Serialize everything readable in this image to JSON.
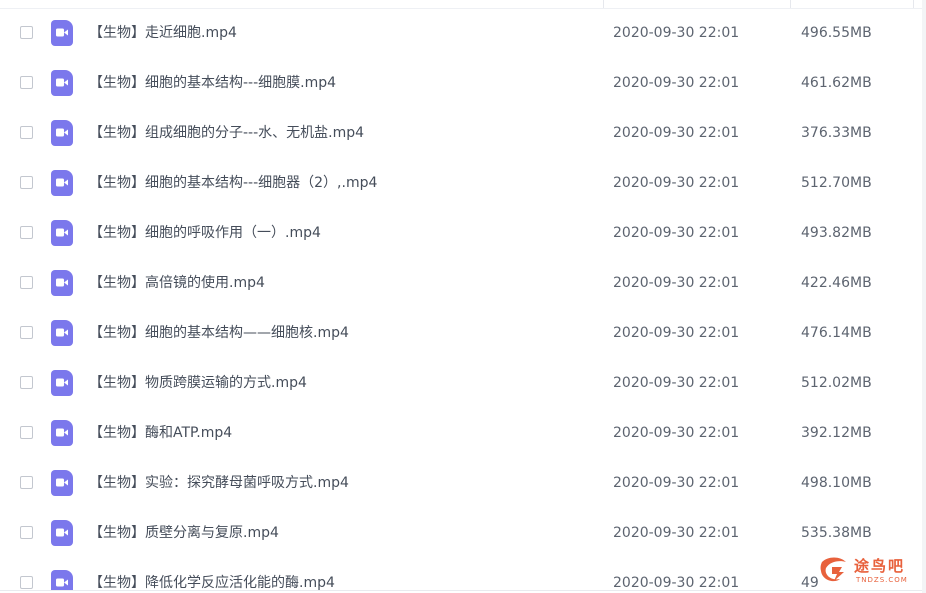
{
  "file_list": {
    "icon": "video-file-icon",
    "accent_color": "#7b78ec",
    "rows": [
      {
        "name": "【生物】走近细胞.mp4",
        "date": "2020-09-30 22:01",
        "size": "496.55MB"
      },
      {
        "name": "【生物】细胞的基本结构---细胞膜.mp4",
        "date": "2020-09-30 22:01",
        "size": "461.62MB"
      },
      {
        "name": "【生物】组成细胞的分子---水、无机盐.mp4",
        "date": "2020-09-30 22:01",
        "size": "376.33MB"
      },
      {
        "name": "【生物】细胞的基本结构---细胞器（2）,.mp4",
        "date": "2020-09-30 22:01",
        "size": "512.70MB"
      },
      {
        "name": "【生物】细胞的呼吸作用（一）.mp4",
        "date": "2020-09-30 22:01",
        "size": "493.82MB"
      },
      {
        "name": "【生物】高倍镜的使用.mp4",
        "date": "2020-09-30 22:01",
        "size": "422.46MB"
      },
      {
        "name": "【生物】细胞的基本结构——细胞核.mp4",
        "date": "2020-09-30 22:01",
        "size": "476.14MB"
      },
      {
        "name": "【生物】物质跨膜运输的方式.mp4",
        "date": "2020-09-30 22:01",
        "size": "512.02MB"
      },
      {
        "name": "【生物】酶和ATP.mp4",
        "date": "2020-09-30 22:01",
        "size": "392.12MB"
      },
      {
        "name": "【生物】实验：探究酵母菌呼吸方式.mp4",
        "date": "2020-09-30 22:01",
        "size": "498.10MB"
      },
      {
        "name": "【生物】质壁分离与复原.mp4",
        "date": "2020-09-30 22:01",
        "size": "535.38MB"
      },
      {
        "name": "【生物】降低化学反应活化能的酶.mp4",
        "date": "2020-09-30 22:01",
        "size": "49"
      }
    ]
  },
  "watermark": {
    "text": "途鸟吧",
    "subtext": "TNDZS.COM",
    "color": "#e8613c"
  }
}
